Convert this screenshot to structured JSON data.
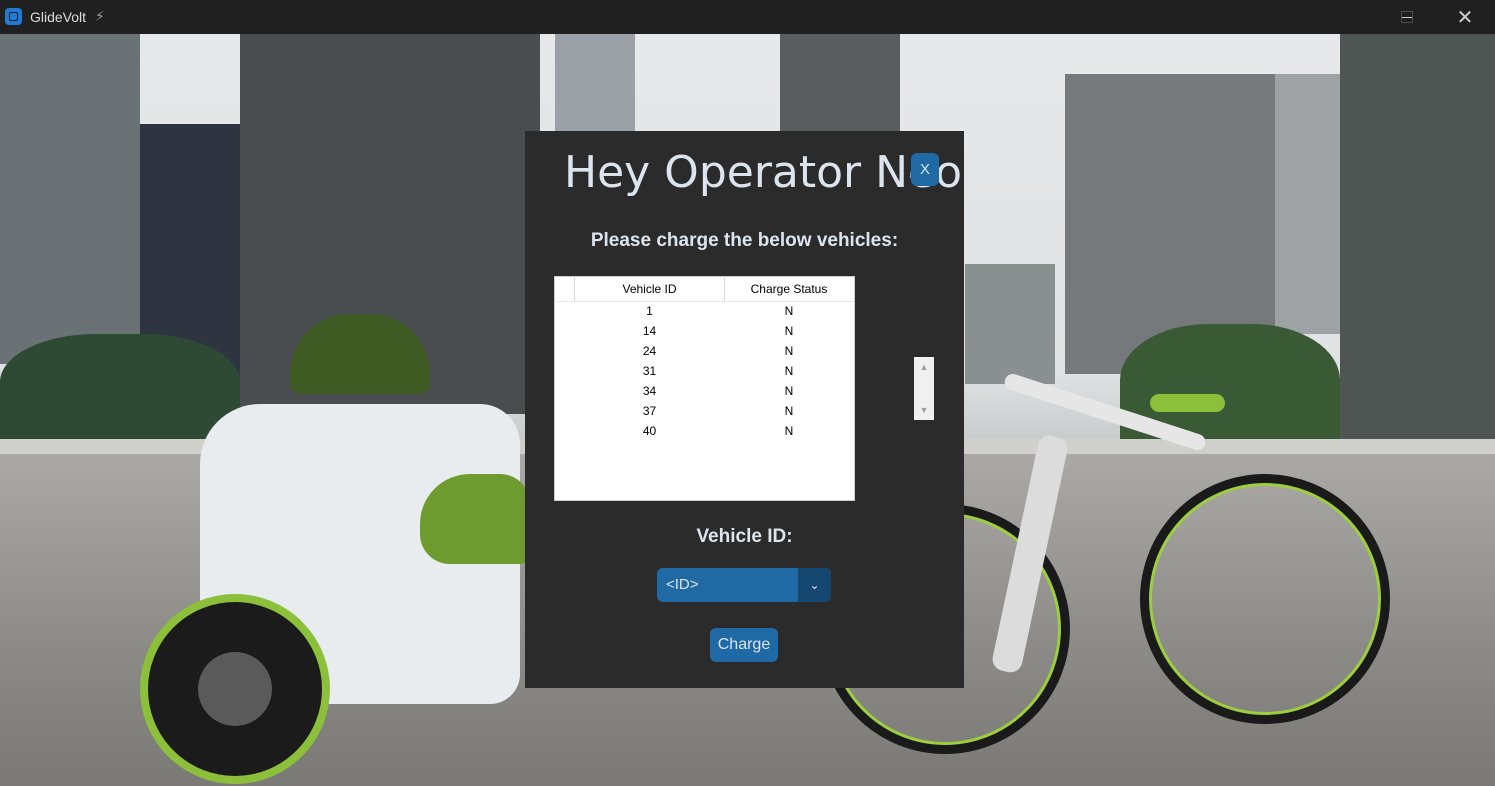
{
  "window": {
    "title": "GlideVolt",
    "title_icon": "bolt-icon",
    "app_icon": "app-icon",
    "minimize_icon": "minimize-icon",
    "maximize_icon": "maximize-icon",
    "close_glyph": "✕"
  },
  "modal": {
    "title": "Hey Operator Neo",
    "close_label": "X",
    "subtitle": "Please charge the below vehicles:",
    "table": {
      "columns": [
        "Vehicle ID",
        "Charge Status"
      ],
      "rows": [
        {
          "id": "1",
          "status": "N"
        },
        {
          "id": "14",
          "status": "N"
        },
        {
          "id": "24",
          "status": "N"
        },
        {
          "id": "31",
          "status": "N"
        },
        {
          "id": "34",
          "status": "N"
        },
        {
          "id": "37",
          "status": "N"
        },
        {
          "id": "40",
          "status": "N"
        }
      ]
    },
    "vehicle_id_label": "Vehicle ID:",
    "vehicle_id_select": {
      "value": "<ID>",
      "icon": "chevron-down-icon"
    },
    "charge_button": "Charge"
  },
  "colors": {
    "accent": "#1f6aa5",
    "accent_dark": "#144870",
    "modal_bg": "#2b2b2b",
    "text": "#dce4ee"
  }
}
